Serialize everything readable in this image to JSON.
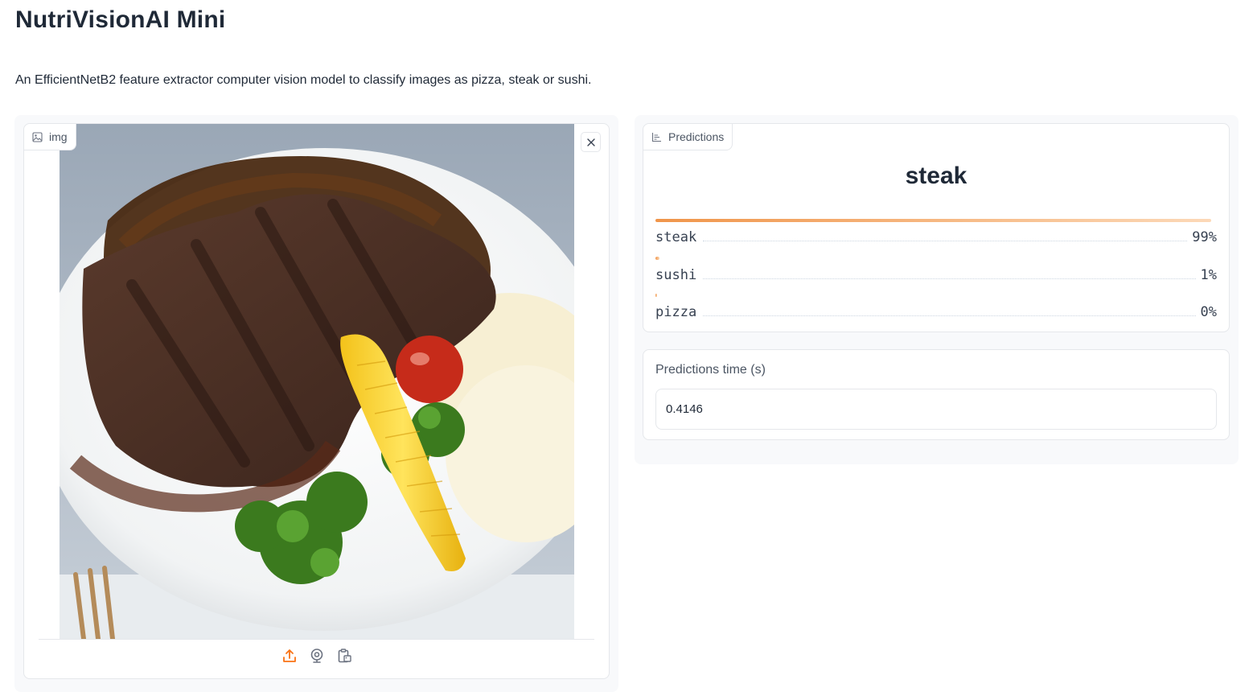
{
  "app": {
    "title": "NutriVisionAI Mini",
    "description": "An EfficientNetB2 feature extractor computer vision model to classify images as pizza, steak or sushi."
  },
  "image_input": {
    "label": "img",
    "label_icon": "image-icon",
    "clear_icon": "close-icon",
    "sources": [
      {
        "name": "upload",
        "icon": "upload-icon"
      },
      {
        "name": "webcam",
        "icon": "webcam-icon"
      },
      {
        "name": "clipboard",
        "icon": "clipboard-icon"
      }
    ]
  },
  "predictions": {
    "label": "Predictions",
    "label_icon": "bar-chart-icon",
    "top_class": "steak",
    "confidences": [
      {
        "name": "steak",
        "pct": "99%",
        "value": 0.99
      },
      {
        "name": "sushi",
        "pct": "1%",
        "value": 0.01
      },
      {
        "name": "pizza",
        "pct": "0%",
        "value": 0.002
      }
    ]
  },
  "prediction_time": {
    "label": "Predictions time (s)",
    "value": "0.4146"
  },
  "colors": {
    "accent": "#f97316",
    "bar_start": "#f0954a",
    "bar_end": "#fcd9b8"
  }
}
